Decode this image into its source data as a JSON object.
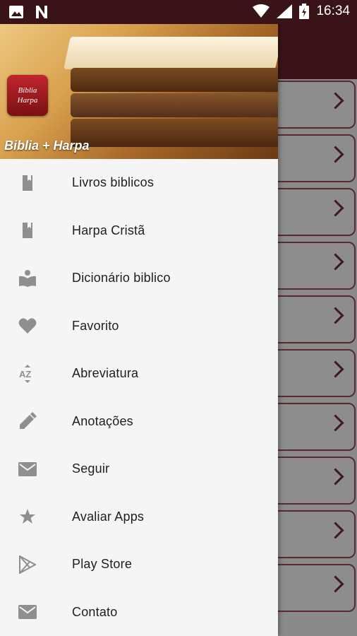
{
  "status_bar": {
    "time": "16:34"
  },
  "drawer": {
    "title": "Biblia + Harpa",
    "app_icon": {
      "line1": "Bíblia",
      "line2": "Harpa"
    },
    "items": [
      {
        "label": "Livros biblicos",
        "icon": "book-icon"
      },
      {
        "label": "Harpa Cristã",
        "icon": "book-icon"
      },
      {
        "label": "Dicionário biblico",
        "icon": "reading-book-icon"
      },
      {
        "label": "Favorito",
        "icon": "heart-icon"
      },
      {
        "label": "Abreviatura",
        "icon": "sort-az-icon"
      },
      {
        "label": "Anotações",
        "icon": "pencil-icon"
      },
      {
        "label": "Seguir",
        "icon": "mail-icon"
      },
      {
        "label": "Avaliar Apps",
        "icon": "star-icon"
      },
      {
        "label": "Play Store",
        "icon": "play-store-icon"
      },
      {
        "label": "Contato",
        "icon": "mail-icon"
      }
    ]
  }
}
